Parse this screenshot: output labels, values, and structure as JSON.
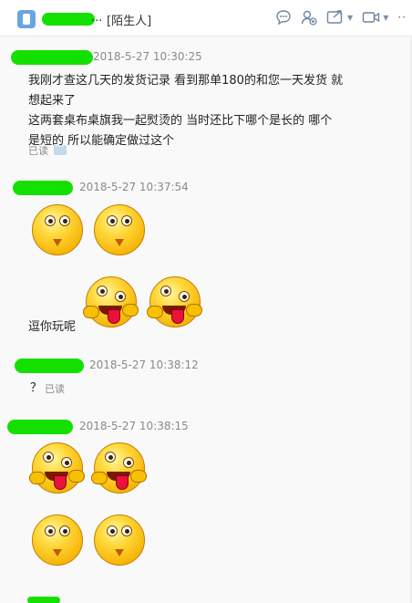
{
  "header": {
    "contact_name_suffix": "...",
    "tag": "[陌生人]",
    "icons": [
      "chat-bubble-icon",
      "add-contact-icon",
      "share-screen-icon",
      "video-call-icon",
      "more-icon"
    ]
  },
  "messages": [
    {
      "time": "2018-5-27 10:30:25",
      "lines": [
        "我刚才查这几天的发货记录 看到那单180的和您一天发货 就",
        "想起来了",
        "这两套桌布桌旗我一起熨烫的 当时还比下哪个是长的 哪个",
        "是短的  所以能确定做过这个"
      ],
      "read_label": "已读"
    },
    {
      "time": "2018-5-27 10:37:54",
      "text": "逗你玩呢",
      "emojis": [
        "smile-face-emoji",
        "smile-face-emoji",
        "tongue-out-emoji",
        "tongue-out-emoji"
      ]
    },
    {
      "time": "2018-5-27 10:38:12",
      "text": "？",
      "read_label": "已读"
    },
    {
      "time": "2018-5-27 10:38:15",
      "emojis": [
        "tongue-out-emoji",
        "tongue-out-emoji",
        "smile-face-emoji",
        "smile-face-emoji"
      ]
    }
  ],
  "colors": {
    "redaction": "#14e000",
    "timestamp": "#8a8a8a",
    "background": "#f9f9f9"
  }
}
